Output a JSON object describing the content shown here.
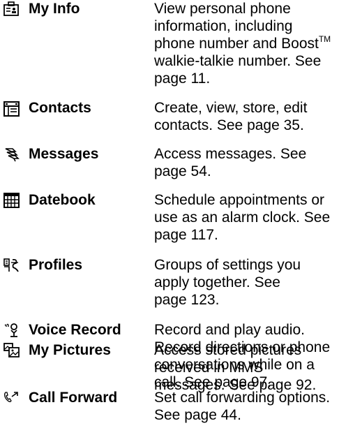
{
  "entries": [
    {
      "name": "My Info",
      "icon": "my-info-icon",
      "lines": [
        "View personal phone",
        "information, including",
        "phone number and Boost",
        "walkie-talkie number. See",
        "page 11."
      ],
      "superscript": "TM"
    },
    {
      "name": "Contacts",
      "icon": "contacts-icon",
      "lines": [
        "Create, view, store, edit",
        "contacts. See page 35."
      ]
    },
    {
      "name": "Messages",
      "icon": "messages-icon",
      "lines": [
        "Access messages. See",
        "page 54."
      ]
    },
    {
      "name": "Datebook",
      "icon": "datebook-icon",
      "lines": [
        "Schedule appointments or",
        "use as an alarm clock. See",
        "page 117."
      ]
    },
    {
      "name": "Profiles",
      "icon": "profiles-icon",
      "lines": [
        "Groups of settings you",
        "apply together. See",
        "page 123."
      ]
    },
    {
      "name": "Voice Record",
      "icon": "voice-record-icon",
      "lines": [
        "Record and play audio.",
        "Record directions or phone",
        "conversations while on a",
        "call. See page 97."
      ]
    },
    {
      "name": "My Pictures",
      "icon": "my-pictures-icon",
      "lines": [
        "Access stored pictures",
        "received in MMS",
        "messages. See page 92."
      ]
    },
    {
      "name": "Call Forward",
      "icon": "call-forward-icon",
      "lines": [
        "Set call forwarding options.",
        "See page 44."
      ]
    }
  ]
}
